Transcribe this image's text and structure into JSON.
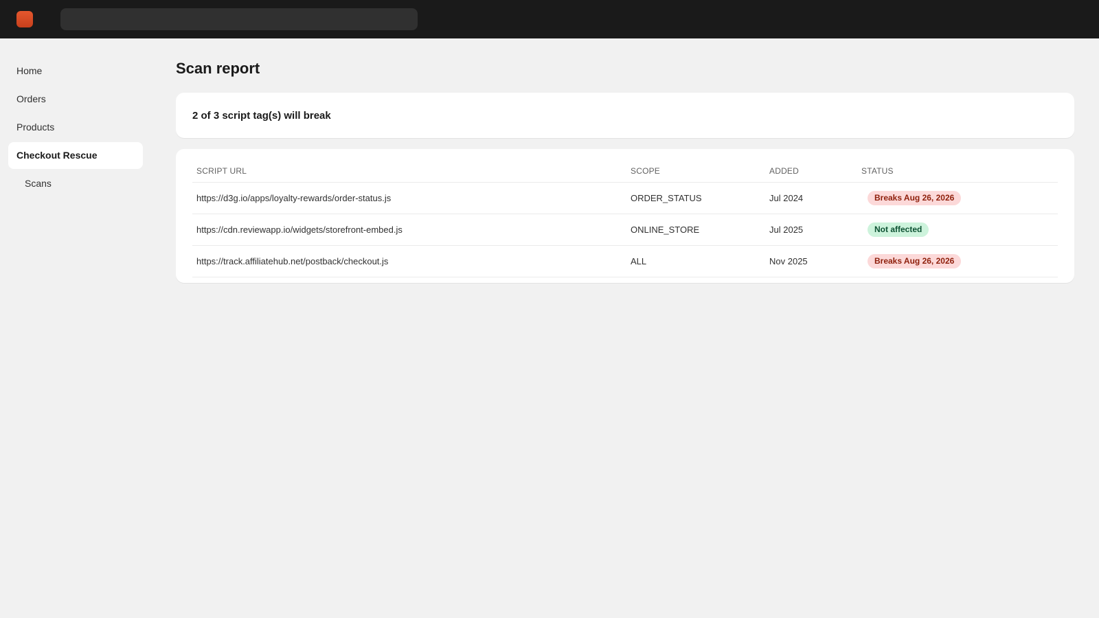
{
  "topbar": {
    "logo_icon": "app-logo-icon",
    "search_placeholder": ""
  },
  "sidebar": {
    "items": [
      {
        "label": "Home"
      },
      {
        "label": "Orders"
      },
      {
        "label": "Products"
      },
      {
        "label": "Checkout Rescue"
      },
      {
        "label": "Scans"
      }
    ]
  },
  "main": {
    "title": "Scan report",
    "summary": "2 of 3 script tag(s) will break",
    "table": {
      "headers": [
        "SCRIPT URL",
        "SCOPE",
        "ADDED",
        "STATUS"
      ],
      "rows": [
        {
          "url": "https://d3g.io/apps/loyalty-rewards/order-status.js",
          "scope": "ORDER_STATUS",
          "added": "Jul 2024",
          "status": "Breaks Aug 26, 2026"
        },
        {
          "url": "https://cdn.reviewapp.io/widgets/storefront-embed.js",
          "scope": "ONLINE_STORE",
          "added": "Jul 2025",
          "status": "Not affected"
        },
        {
          "url": "https://track.affiliatehub.net/postback/checkout.js",
          "scope": "ALL",
          "added": "Nov 2025",
          "status": "Breaks Aug 26, 2026"
        }
      ]
    }
  },
  "colors": {
    "topbar": "#1a1a1a",
    "accent": "#e4572e",
    "badge_breaks_bg": "#fcd9d9",
    "badge_breaks_text": "#8e1f0b",
    "badge_ok_bg": "#cdf3dc",
    "badge_ok_text": "#0c5132"
  }
}
